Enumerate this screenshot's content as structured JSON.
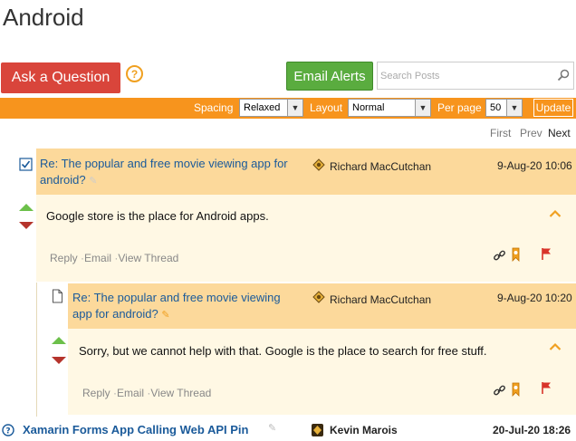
{
  "page": {
    "title": "Android"
  },
  "actions": {
    "ask_label": "Ask a Question",
    "help_glyph": "?",
    "alerts_label": "Email Alerts"
  },
  "search": {
    "placeholder": "Search Posts"
  },
  "toolbar": {
    "spacing_label": "Spacing",
    "spacing_value": "Relaxed",
    "layout_label": "Layout",
    "layout_value": "Normal",
    "perpage_label": "Per page",
    "perpage_value": "50",
    "update_label": "Update"
  },
  "pager": {
    "first": "First",
    "prev": "Prev",
    "next": "Next"
  },
  "posts": [
    {
      "title_line1": "Re: The popular and free movie viewing app for",
      "title_line2": "android?",
      "author": "Richard MacCutchan",
      "date": "9-Aug-20 10:06",
      "body": "Google store is the place for Android apps.",
      "reply": "Reply",
      "email": "Email",
      "view_thread": "View Thread"
    },
    {
      "title_line1": "Re: The popular and free movie viewing",
      "title_line2": "app for android?",
      "author": "Richard MacCutchan",
      "date": "9-Aug-20 10:20",
      "body": "Sorry, but we cannot help with that. Google is the place to search for free stuff.",
      "reply": "Reply",
      "email": "Email",
      "view_thread": "View Thread"
    }
  ],
  "next_thread": {
    "title": "Xamarin Forms App Calling Web API Pin",
    "author": "Kevin Marois",
    "date": "20-Jul-20 18:26"
  },
  "separator": "·",
  "colors": {
    "accent": "#f7941d",
    "ask": "#d9453b",
    "alerts": "#5aac3f",
    "link": "#1a5a9a"
  }
}
